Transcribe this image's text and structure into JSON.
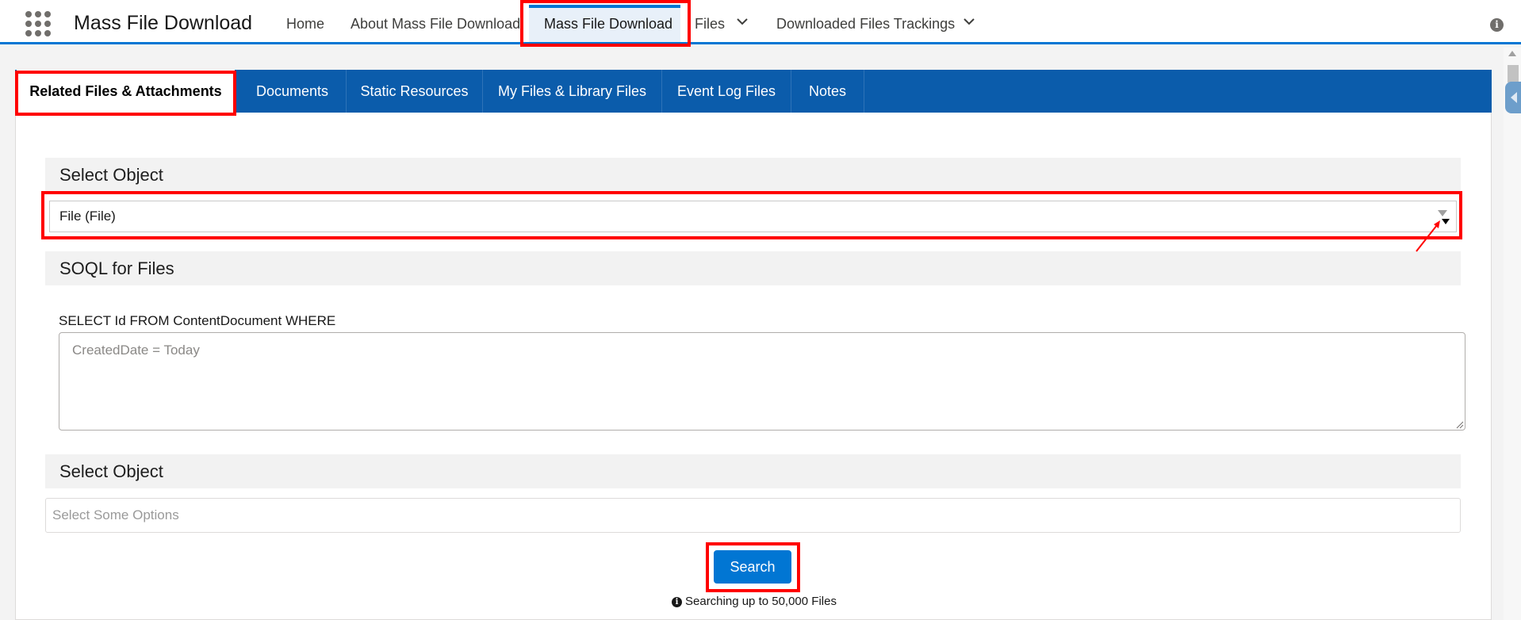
{
  "app": {
    "title": "Mass File Download"
  },
  "nav": {
    "items": [
      {
        "label": "Home"
      },
      {
        "label": "About Mass File Download"
      },
      {
        "label": "Mass File Download",
        "active": true
      },
      {
        "label": "Files",
        "has_dropdown": true
      },
      {
        "label": "Downloaded Files Trackings",
        "has_dropdown": true
      }
    ]
  },
  "tabs": [
    {
      "label": "Related Files & Attachments",
      "active": true
    },
    {
      "label": "Documents"
    },
    {
      "label": "Static Resources"
    },
    {
      "label": "My Files & Library Files"
    },
    {
      "label": "Event Log Files"
    },
    {
      "label": "Notes"
    }
  ],
  "form": {
    "select_object_header": "Select Object",
    "select_object_value": "File (File)",
    "soql_header": "SOQL for Files",
    "soql_prefix": "SELECT Id FROM ContentDocument WHERE",
    "soql_placeholder": "CreatedDate = Today",
    "select_object2_header": "Select Object",
    "multi_select_placeholder": "Select Some Options",
    "search_button": "Search",
    "hint": "Searching up to 50,000 Files"
  },
  "icons": {
    "app_launcher": "waffle-icon",
    "info": "info-icon",
    "hint": "info-icon"
  },
  "colors": {
    "brand": "#0176d3",
    "tabbar": "#0b5cab",
    "annotation": "#ff0000"
  }
}
